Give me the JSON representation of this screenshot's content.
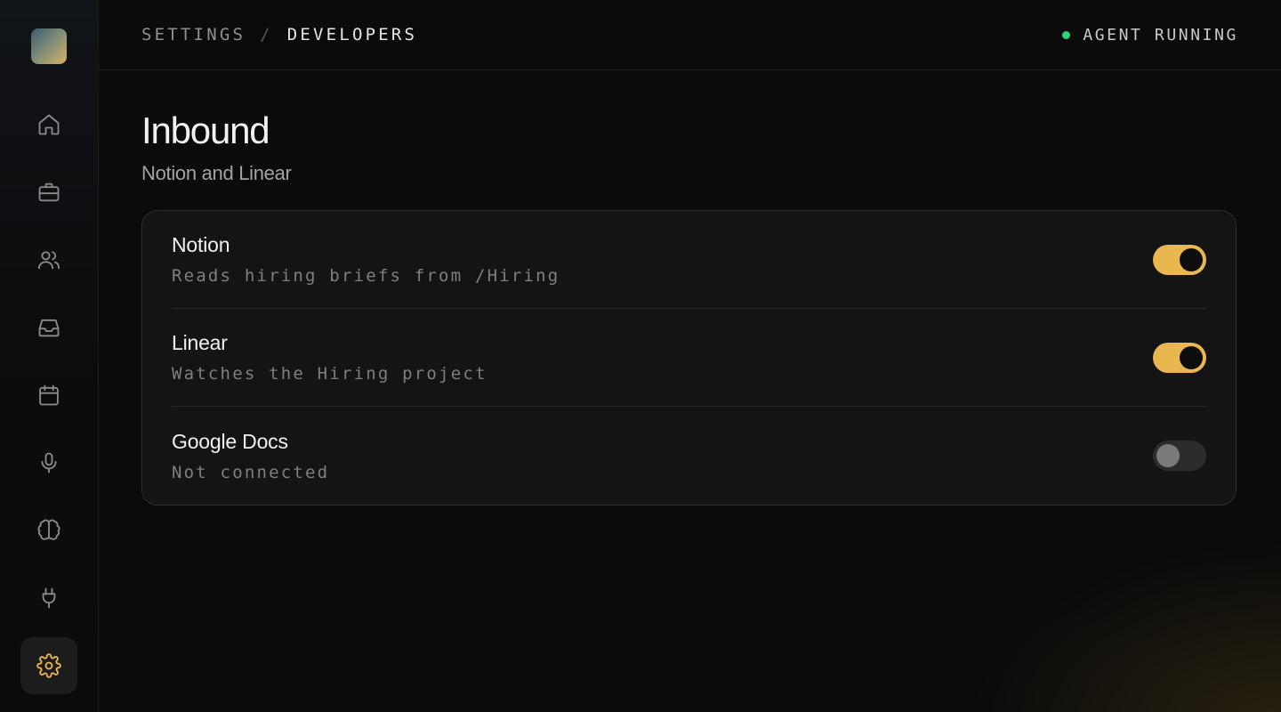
{
  "breadcrumb": {
    "parent": "SETTINGS",
    "separator": "/",
    "current": "DEVELOPERS"
  },
  "status": {
    "label": "AGENT RUNNING",
    "color": "#2ed37a"
  },
  "sidebar": {
    "items": [
      {
        "icon": "home-icon",
        "active": false
      },
      {
        "icon": "briefcase-icon",
        "active": false
      },
      {
        "icon": "users-icon",
        "active": false
      },
      {
        "icon": "inbox-icon",
        "active": false
      },
      {
        "icon": "calendar-icon",
        "active": false
      },
      {
        "icon": "microphone-icon",
        "active": false
      },
      {
        "icon": "brain-icon",
        "active": false
      },
      {
        "icon": "plug-icon",
        "active": false
      },
      {
        "icon": "gear-icon",
        "active": true
      }
    ]
  },
  "page": {
    "title": "Inbound",
    "subtitle": "Notion and Linear"
  },
  "integrations": [
    {
      "name": "Notion",
      "description": "Reads hiring briefs from /Hiring",
      "enabled": true
    },
    {
      "name": "Linear",
      "description": "Watches the Hiring project",
      "enabled": true
    },
    {
      "name": "Google Docs",
      "description": "Not connected",
      "enabled": false
    }
  ],
  "colors": {
    "accent": "#e9b64f",
    "background": "#0b0b0b",
    "card": "#141414"
  }
}
